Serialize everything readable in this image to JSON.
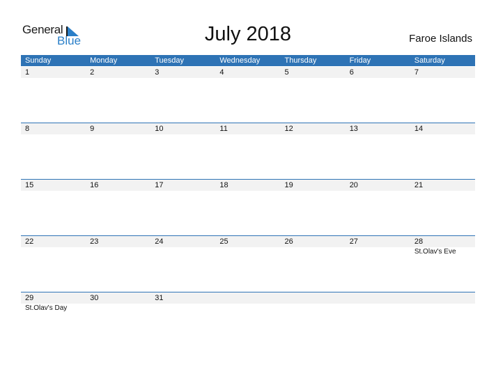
{
  "logo": {
    "word1": "General",
    "word2": "Blue",
    "accent_color": "#2a7fc8"
  },
  "title": "July 2018",
  "country": "Faroe Islands",
  "header_color": "#2e73b5",
  "weekdays": [
    "Sunday",
    "Monday",
    "Tuesday",
    "Wednesday",
    "Thursday",
    "Friday",
    "Saturday"
  ],
  "weeks": [
    [
      {
        "day": "1",
        "event": ""
      },
      {
        "day": "2",
        "event": ""
      },
      {
        "day": "3",
        "event": ""
      },
      {
        "day": "4",
        "event": ""
      },
      {
        "day": "5",
        "event": ""
      },
      {
        "day": "6",
        "event": ""
      },
      {
        "day": "7",
        "event": ""
      }
    ],
    [
      {
        "day": "8",
        "event": ""
      },
      {
        "day": "9",
        "event": ""
      },
      {
        "day": "10",
        "event": ""
      },
      {
        "day": "11",
        "event": ""
      },
      {
        "day": "12",
        "event": ""
      },
      {
        "day": "13",
        "event": ""
      },
      {
        "day": "14",
        "event": ""
      }
    ],
    [
      {
        "day": "15",
        "event": ""
      },
      {
        "day": "16",
        "event": ""
      },
      {
        "day": "17",
        "event": ""
      },
      {
        "day": "18",
        "event": ""
      },
      {
        "day": "19",
        "event": ""
      },
      {
        "day": "20",
        "event": ""
      },
      {
        "day": "21",
        "event": ""
      }
    ],
    [
      {
        "day": "22",
        "event": ""
      },
      {
        "day": "23",
        "event": ""
      },
      {
        "day": "24",
        "event": ""
      },
      {
        "day": "25",
        "event": ""
      },
      {
        "day": "26",
        "event": ""
      },
      {
        "day": "27",
        "event": ""
      },
      {
        "day": "28",
        "event": "St.Olav's Eve"
      }
    ],
    [
      {
        "day": "29",
        "event": "St.Olav's Day"
      },
      {
        "day": "30",
        "event": ""
      },
      {
        "day": "31",
        "event": ""
      },
      {
        "day": "",
        "event": ""
      },
      {
        "day": "",
        "event": ""
      },
      {
        "day": "",
        "event": ""
      },
      {
        "day": "",
        "event": ""
      }
    ]
  ]
}
